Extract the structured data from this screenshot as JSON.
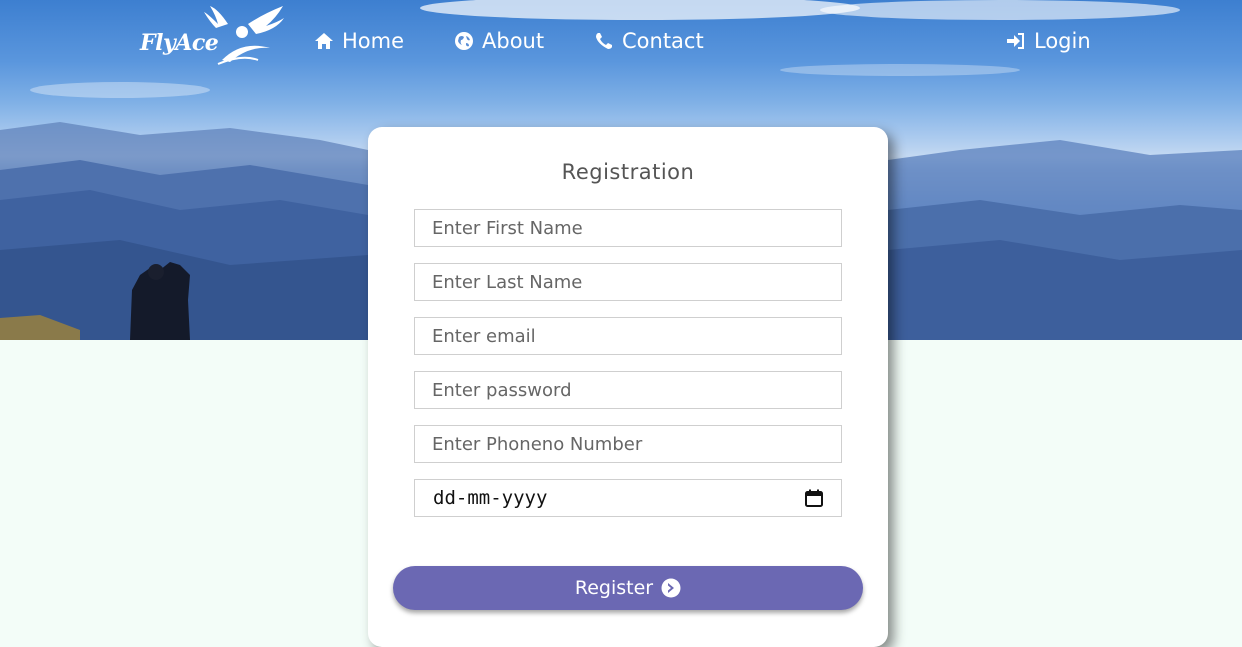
{
  "brand": {
    "logo_text": "FlyAce"
  },
  "nav": {
    "home": {
      "label": "Home",
      "icon": "home-icon"
    },
    "about": {
      "label": "About",
      "icon": "globe-icon"
    },
    "contact": {
      "label": "Contact",
      "icon": "phone-icon"
    },
    "login": {
      "label": "Login",
      "icon": "sign-in-icon"
    }
  },
  "form": {
    "title": "Registration",
    "first_name": {
      "placeholder": "Enter First Name",
      "value": ""
    },
    "last_name": {
      "placeholder": "Enter Last Name",
      "value": ""
    },
    "email": {
      "placeholder": "Enter email",
      "value": ""
    },
    "password": {
      "placeholder": "Enter password",
      "value": ""
    },
    "phone": {
      "placeholder": "Enter Phoneno Number",
      "value": ""
    },
    "date": {
      "value": "dd-mm-yyyy",
      "icon": "calendar-icon"
    },
    "submit": {
      "label": "Register",
      "icon": "chevron-circle-right-icon"
    }
  },
  "colors": {
    "accent": "#6b68b3",
    "page_bg": "#f3fdf8",
    "nav_text": "#ffffff"
  }
}
